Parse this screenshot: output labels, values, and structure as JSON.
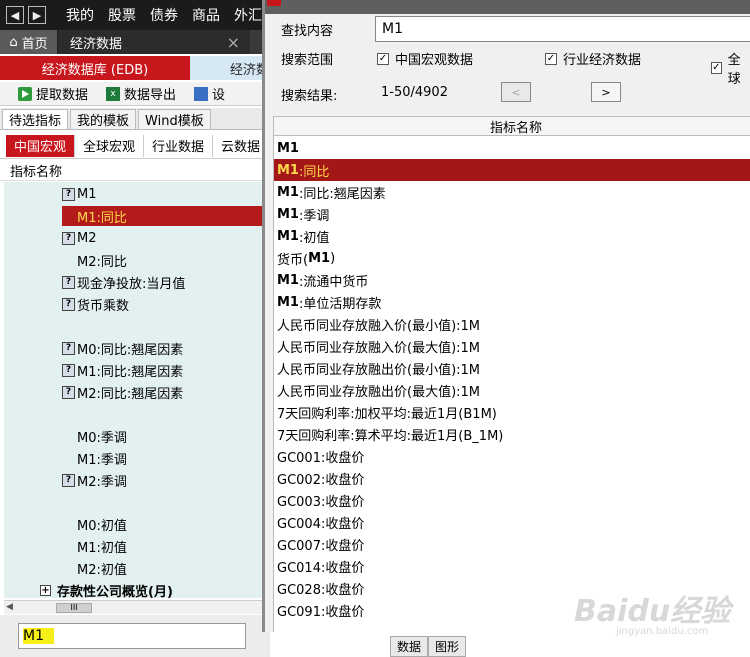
{
  "menubar": {
    "items": [
      "我的",
      "股票",
      "债券",
      "商品",
      "外汇"
    ]
  },
  "tabs": {
    "home": "首页",
    "active": "经济数据"
  },
  "edb": {
    "active": "经济数据库 (EDB)",
    "other": "经济数"
  },
  "toolbar": {
    "extract": "提取数据",
    "export": "数据导出",
    "settings": "设"
  },
  "subtabs": [
    "待选指标",
    "我的模板",
    "Wind模板"
  ],
  "cattabs": [
    "中国宏观",
    "全球宏观",
    "行业数据",
    "云数据"
  ],
  "left_column_header": "指标名称",
  "tree": [
    {
      "label": "M1",
      "q": true
    },
    {
      "label": "M1:同比",
      "q": false,
      "selected": true
    },
    {
      "label": "M2",
      "q": true
    },
    {
      "label": "M2:同比",
      "q": false
    },
    {
      "label": "现金净投放:当月值",
      "q": true
    },
    {
      "label": "货币乘数",
      "q": true
    },
    {
      "label": "",
      "q": false
    },
    {
      "label": "M0:同比:翘尾因素",
      "q": true
    },
    {
      "label": "M1:同比:翘尾因素",
      "q": true
    },
    {
      "label": "M2:同比:翘尾因素",
      "q": true
    },
    {
      "label": "",
      "q": false
    },
    {
      "label": "M0:季调",
      "q": false
    },
    {
      "label": "M1:季调",
      "q": false
    },
    {
      "label": "M2:季调",
      "q": true
    },
    {
      "label": "",
      "q": false
    },
    {
      "label": "M0:初值",
      "q": false
    },
    {
      "label": "M1:初值",
      "q": false
    },
    {
      "label": "M2:初值",
      "q": false
    },
    {
      "label": "存款性公司概览(月)",
      "folder": true
    }
  ],
  "scroll_grip": "III",
  "bottom_search": {
    "value": "M1"
  },
  "bottom_tabs": [
    "数据",
    "图形"
  ],
  "dialog": {
    "find_label": "查找内容",
    "find_value": "M1",
    "scope_label": "搜索范围",
    "scopes": [
      "中国宏观数据",
      "行业经济数据",
      "全球"
    ],
    "result_label": "搜索结果:",
    "result_range": "1-50/4902",
    "prev": "<",
    "next": ">",
    "col_header": "指标名称",
    "rows": [
      {
        "parts": [
          [
            "M1",
            true
          ]
        ]
      },
      {
        "parts": [
          [
            "M1",
            true
          ],
          [
            ":同比",
            false
          ]
        ],
        "selected": true
      },
      {
        "parts": [
          [
            "M1",
            true
          ],
          [
            ":同比:翘尾因素",
            false
          ]
        ]
      },
      {
        "parts": [
          [
            "M1",
            true
          ],
          [
            ":季调",
            false
          ]
        ]
      },
      {
        "parts": [
          [
            "M1",
            true
          ],
          [
            ":初值",
            false
          ]
        ]
      },
      {
        "parts": [
          [
            "货币(",
            false
          ],
          [
            "M1",
            true
          ],
          [
            ")",
            false
          ]
        ]
      },
      {
        "parts": [
          [
            "M1",
            true
          ],
          [
            ":流通中货币",
            false
          ]
        ]
      },
      {
        "parts": [
          [
            "M1",
            true
          ],
          [
            ":单位活期存款",
            false
          ]
        ]
      },
      {
        "parts": [
          [
            "人民币同业存放融入价(最小值):1M",
            false
          ]
        ]
      },
      {
        "parts": [
          [
            "人民币同业存放融入价(最大值):1M",
            false
          ]
        ]
      },
      {
        "parts": [
          [
            "人民币同业存放融出价(最小值):1M",
            false
          ]
        ]
      },
      {
        "parts": [
          [
            "人民币同业存放融出价(最大值):1M",
            false
          ]
        ]
      },
      {
        "parts": [
          [
            "7天回购利率:加权平均:最近1月(B1M)",
            false
          ]
        ]
      },
      {
        "parts": [
          [
            "7天回购利率:算术平均:最近1月(B_1M)",
            false
          ]
        ]
      },
      {
        "parts": [
          [
            "GC001:收盘价",
            false
          ]
        ]
      },
      {
        "parts": [
          [
            "GC002:收盘价",
            false
          ]
        ]
      },
      {
        "parts": [
          [
            "GC003:收盘价",
            false
          ]
        ]
      },
      {
        "parts": [
          [
            "GC004:收盘价",
            false
          ]
        ]
      },
      {
        "parts": [
          [
            "GC007:收盘价",
            false
          ]
        ]
      },
      {
        "parts": [
          [
            "GC014:收盘价",
            false
          ]
        ]
      },
      {
        "parts": [
          [
            "GC028:收盘价",
            false
          ]
        ]
      },
      {
        "parts": [
          [
            "GC091:收盘价",
            false
          ]
        ]
      }
    ]
  },
  "watermark": {
    "logo": "Baidu经验",
    "url": "jingyan.baidu.com"
  },
  "colors": {
    "accent_red": "#c8161d",
    "selected_text": "#ffd84a",
    "highlight_yellow": "#f6ef18"
  }
}
